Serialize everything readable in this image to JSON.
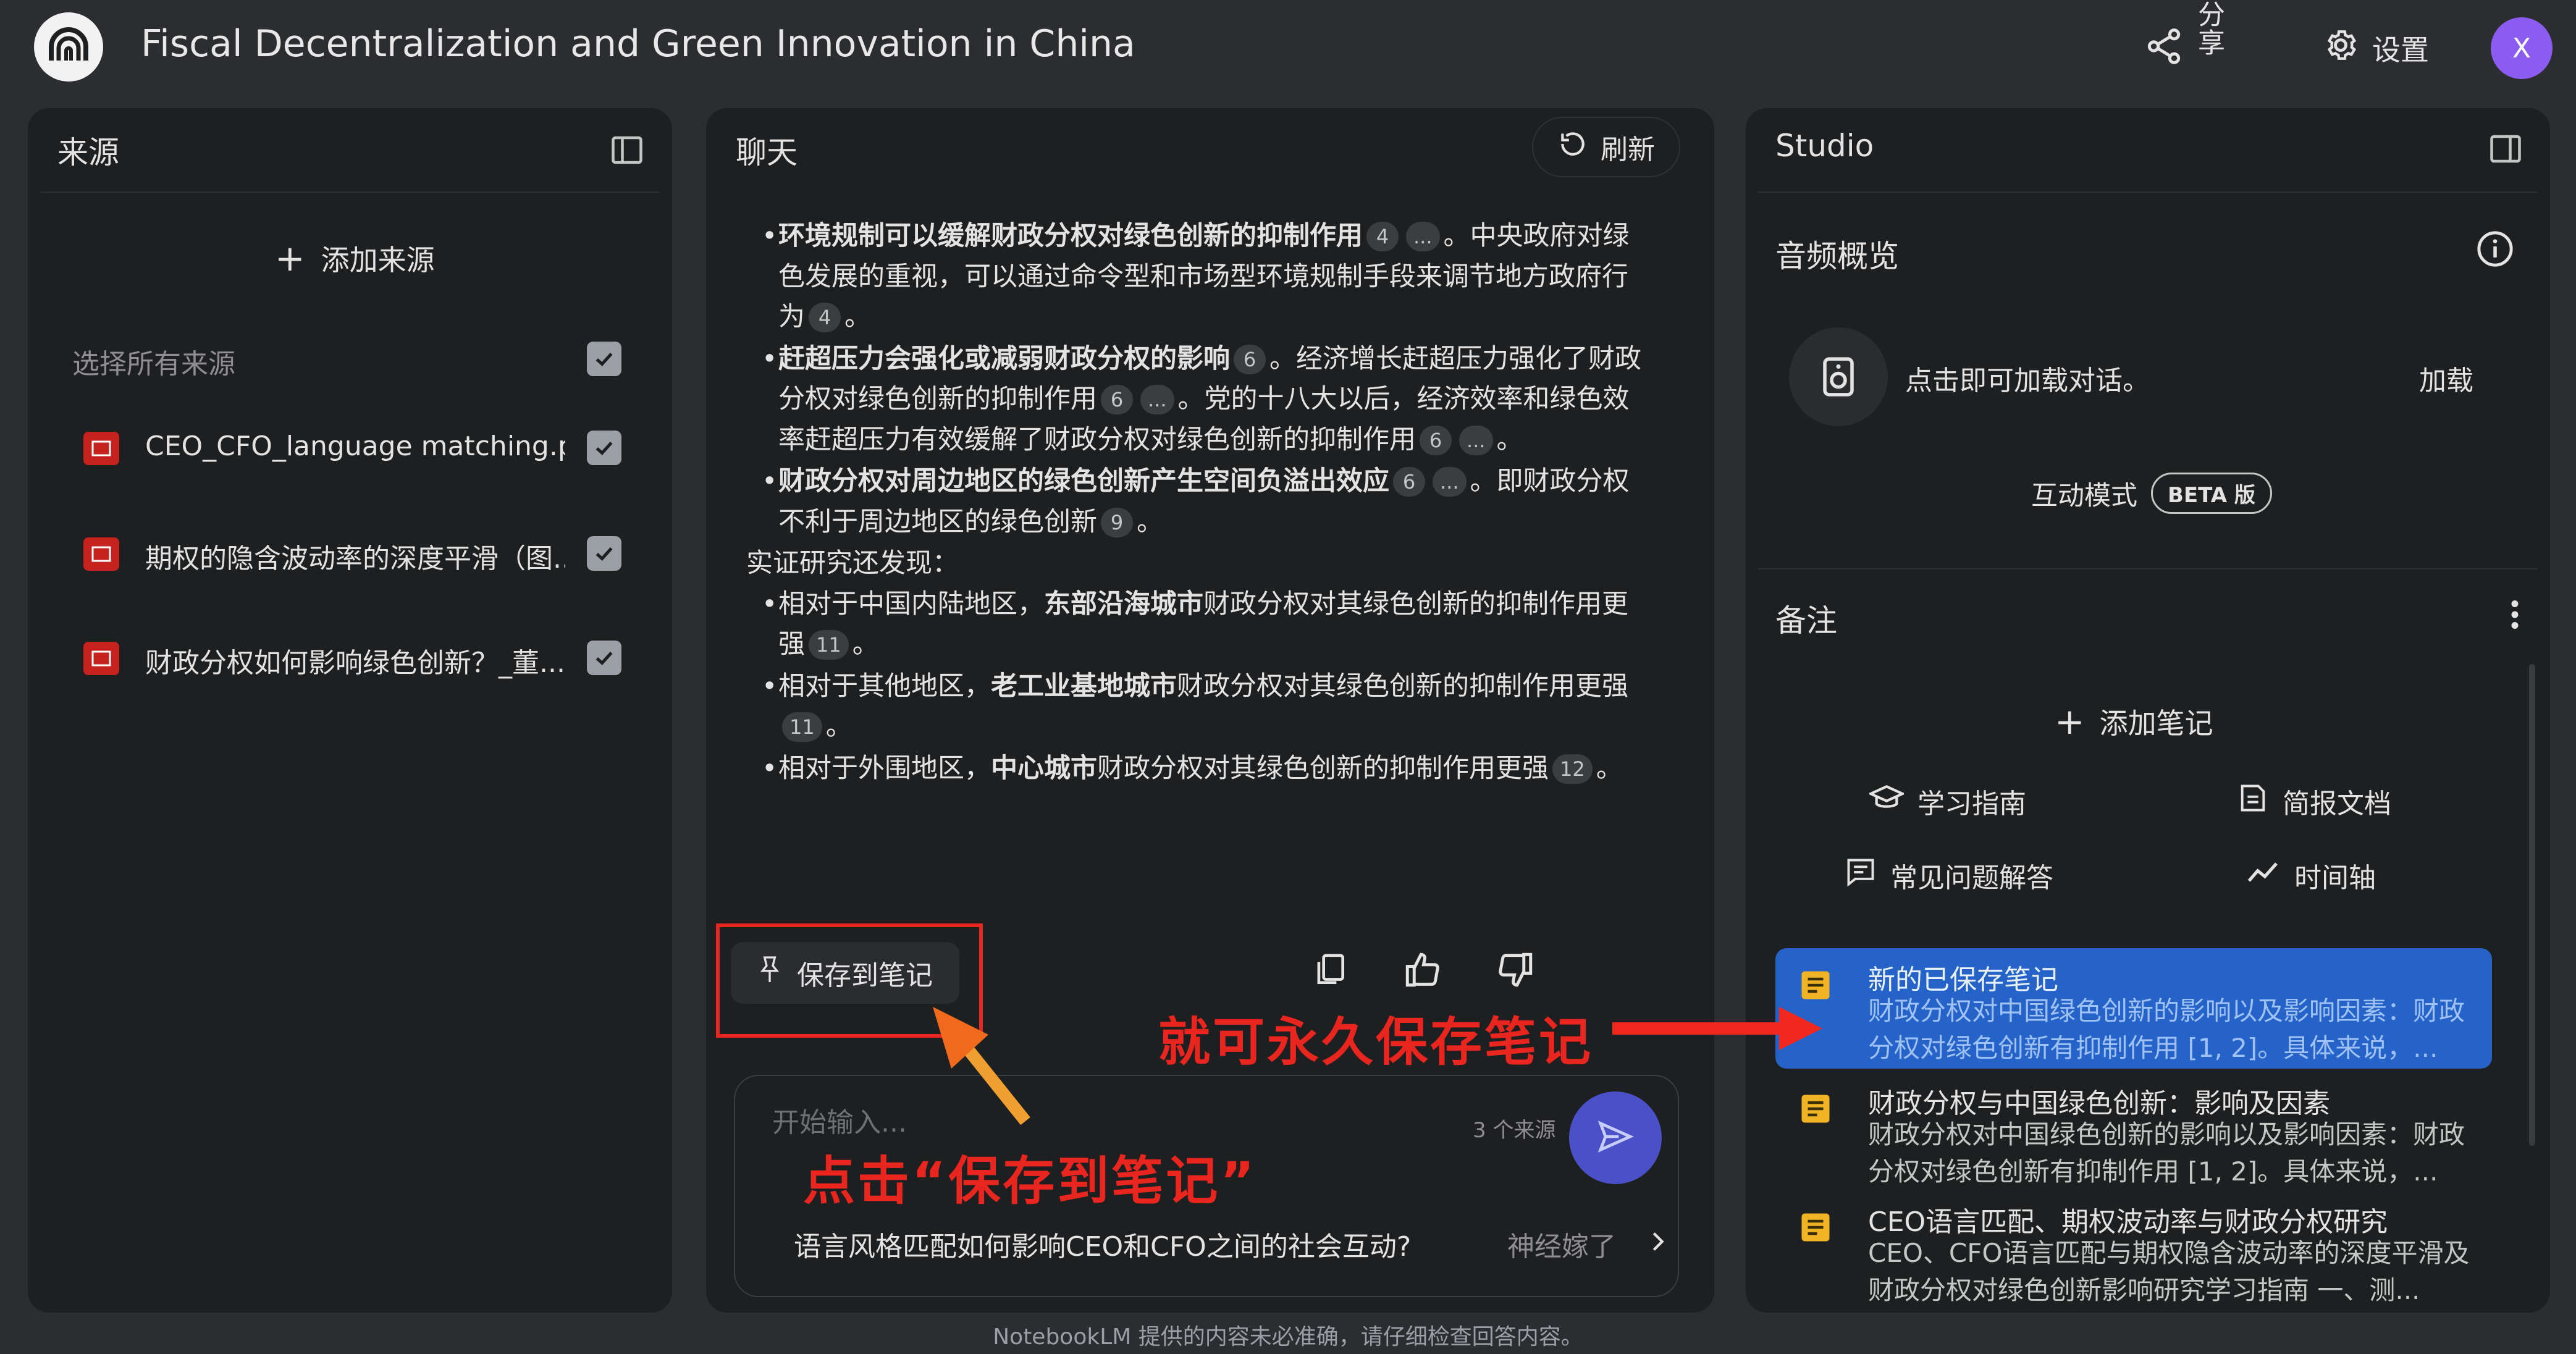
{
  "header": {
    "title": "Fiscal Decentralization and Green Innovation in China",
    "share_label": "分享",
    "settings_label": "设置",
    "avatar_letter": "X"
  },
  "sources": {
    "title": "来源",
    "add_label": "添加来源",
    "select_all_label": "选择所有来源",
    "items": [
      {
        "name": "CEO_CFO_language matching.pdf"
      },
      {
        "name": "期权的隐含波动率的深度平滑（图..."
      },
      {
        "name": "财政分权如何影响绿色创新？_董..."
      }
    ]
  },
  "chat": {
    "title": "聊天",
    "refresh_label": "刷新",
    "bullets": [
      {
        "bold": "环境规制可以缓解财政分权对绿色创新的抑制作用",
        "c1": "4",
        "c1b": "...",
        "rest": "。中央政府对绿色发展的重视，可以通过命令型和市场型环境规制手段来调节地方政府行为",
        "c2": "4",
        "end": "。"
      },
      {
        "bold": "赶超压力会强化或减弱财政分权的影响",
        "c1": "6",
        "rest": "。经济增长赶超压力强化了财政分权对绿色创新的抑制作用",
        "c2": "6",
        "c2b": "...",
        "rest2": "。党的十八大以后，经济效率和绿色效率赶超压力有效缓解了财政分权对绿色创新的抑制作用",
        "c3": "6",
        "c3b": "...",
        "end": "。"
      },
      {
        "bold": "财政分权对周边地区的绿色创新产生空间负溢出效应",
        "c1": "6",
        "c1b": "...",
        "rest": "。即财政分权不利于周边地区的绿色创新",
        "c2": "9",
        "end": "。"
      }
    ],
    "findings_intro": "实证研究还发现：",
    "findings": [
      {
        "pre": "相对于中国内陆地区，",
        "bold": "东部沿海城市",
        "post": "财政分权对其绿色创新的抑制作用更强",
        "cite": "11",
        "end": "。"
      },
      {
        "pre": "相对于其他地区，",
        "bold": "老工业基地城市",
        "post": "财政分权对其绿色创新的抑制作用更强",
        "cite": "11",
        "end": "。"
      },
      {
        "pre": "相对于外围地区，",
        "bold": "中心城市",
        "post": "财政分权对其绿色创新的抑制作用更强",
        "cite": "12",
        "end": "。"
      }
    ],
    "save_note_label": "保存到笔记",
    "input_placeholder": "开始输入...",
    "source_count": "3 个来源",
    "suggestion": "语言风格匹配如何影响CEO和CFO之间的社会互动?",
    "suggestion_2": "神经嫁了"
  },
  "studio": {
    "title": "Studio",
    "audio_title": "音频概览",
    "audio_text": "点击即可加载对话。",
    "audio_load": "加载",
    "interactive_mode": "互动模式",
    "beta_label": "BETA 版",
    "notes_title": "备注",
    "add_note_label": "添加笔记",
    "tools": [
      "学习指南",
      "简报文档",
      "常见问题解答",
      "时间轴"
    ],
    "notes": [
      {
        "title": "新的已保存笔记",
        "body": "财政分权对中国绿色创新的影响以及影响因素：财政分权对绿色创新有抑制作用 [1, 2]。具体来说，..."
      },
      {
        "title": "财政分权与中国绿色创新：影响及因素",
        "body": "财政分权对中国绿色创新的影响以及影响因素：财政分权对绿色创新有抑制作用 [1, 2]。具体来说，..."
      },
      {
        "title": "CEO语言匹配、期权波动率与财政分权研究",
        "body": "CEO、CFO语言匹配与期权隐含波动率的深度平滑及财政分权对绿色创新影响研究学习指南 一、测..."
      }
    ]
  },
  "annotations": {
    "permanent_save": "就可永久保存笔记",
    "click_save": "点击“保存到笔记”"
  },
  "footer": "NotebookLM 提供的内容未必准确，请仔细检查回答内容。",
  "colors": {
    "background": "#2c2d30",
    "panel": "#1e1f20",
    "highlight_note": "#2563c9",
    "annotation_red": "#e8261f",
    "send_button": "#4a50c8",
    "avatar": "#8c5cf0"
  }
}
